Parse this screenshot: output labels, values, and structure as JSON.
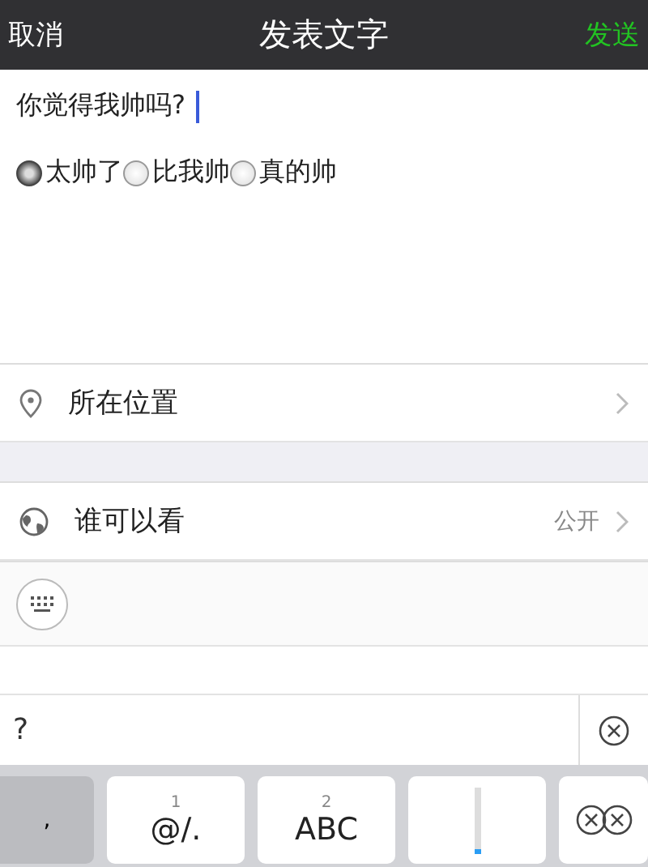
{
  "nav": {
    "cancel": "取消",
    "title": "发表文字",
    "send": "发送"
  },
  "post": {
    "value": "你觉得我帅吗?"
  },
  "options": [
    {
      "label": "太帅了",
      "selected": true
    },
    {
      "label": "比我帅",
      "selected": false
    },
    {
      "label": "真的帅",
      "selected": false
    }
  ],
  "location": {
    "label": "所在位置"
  },
  "visibility": {
    "label": "谁可以看",
    "value": "公开"
  },
  "candidate": {
    "text": "?"
  },
  "keys": [
    {
      "kind": "punct",
      "label": ","
    },
    {
      "kind": "char",
      "number": "1",
      "label": "@/."
    },
    {
      "kind": "char",
      "number": "2",
      "label": "ABC"
    },
    {
      "kind": "blank"
    },
    {
      "kind": "delete"
    }
  ]
}
